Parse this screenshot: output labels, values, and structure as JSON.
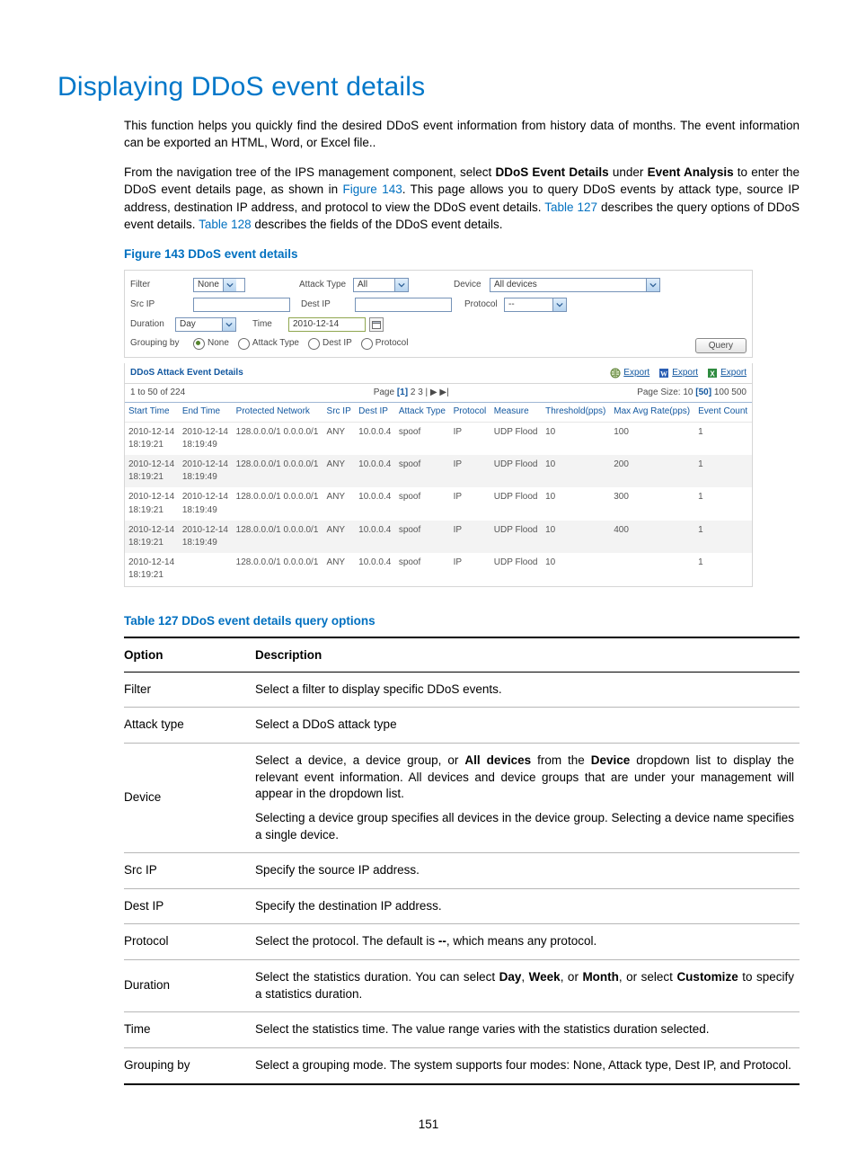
{
  "heading": "Displaying DDoS event details",
  "intro1": "This function helps you quickly find the desired DDoS event information from history data of months. The event information can be exported an HTML, Word, or Excel file..",
  "intro2": {
    "t1": "From the navigation tree of the IPS management component, select ",
    "b1": "DDoS Event Details",
    "t2": " under ",
    "b2": "Event Analysis",
    "t3": " to enter the DDoS event details page, as shown in ",
    "l1": "Figure 143",
    "t4": ". This page allows you to query DDoS events by attack type, source IP address, destination IP address, and protocol to view the DDoS event details. ",
    "l2": "Table 127",
    "t5": " describes the query options of DDoS event details. ",
    "l3": "Table 128",
    "t6": " describes the fields of the DDoS event details."
  },
  "figure_caption": "Figure 143 DDoS event details",
  "filters": {
    "filter_lbl": "Filter",
    "filter_val": "None",
    "attack_lbl": "Attack Type",
    "attack_val": "All",
    "device_lbl": "Device",
    "device_val": "All devices",
    "src_lbl": "Src IP",
    "dest_lbl": "Dest IP",
    "proto_lbl": "Protocol",
    "proto_val": "--",
    "dur_lbl": "Duration",
    "dur_val": "Day",
    "time_lbl": "Time",
    "time_val": "2010-12-14",
    "group_lbl": "Grouping by",
    "g_none": "None",
    "g_attack": "Attack Type",
    "g_dest": "Dest IP",
    "g_proto": "Protocol",
    "query_btn": "Query"
  },
  "details": {
    "title": "DDoS Attack Event Details",
    "export": "Export",
    "count": "1 to 50 of 224",
    "pager_prefix": "Page ",
    "pager_current": "[1]",
    "pager_rest": " 2 3 | ▶  ▶|",
    "pagesize_prefix": "Page Size: 10 ",
    "pagesize_mid": "[50]",
    "pagesize_suffix": " 100 500",
    "cols": [
      "Start Time",
      "End Time",
      "Protected Network",
      "Src IP",
      "Dest IP",
      "Attack Type",
      "Protocol",
      "Measure",
      "Threshold(pps)",
      "Max Avg Rate(pps)",
      "Event Count"
    ],
    "rows": [
      {
        "start": "2010-12-14 18:19:21",
        "end": "2010-12-14 18:19:49",
        "net": "128.0.0.0/1 0.0.0.0/1",
        "src": "ANY",
        "dst": "10.0.0.4",
        "atk": "spoof",
        "proto": "IP",
        "meas": "UDP Flood",
        "th": "10",
        "rate": "100",
        "cnt": "1"
      },
      {
        "start": "2010-12-14 18:19:21",
        "end": "2010-12-14 18:19:49",
        "net": "128.0.0.0/1 0.0.0.0/1",
        "src": "ANY",
        "dst": "10.0.0.4",
        "atk": "spoof",
        "proto": "IP",
        "meas": "UDP Flood",
        "th": "10",
        "rate": "200",
        "cnt": "1"
      },
      {
        "start": "2010-12-14 18:19:21",
        "end": "2010-12-14 18:19:49",
        "net": "128.0.0.0/1 0.0.0.0/1",
        "src": "ANY",
        "dst": "10.0.0.4",
        "atk": "spoof",
        "proto": "IP",
        "meas": "UDP Flood",
        "th": "10",
        "rate": "300",
        "cnt": "1"
      },
      {
        "start": "2010-12-14 18:19:21",
        "end": "2010-12-14 18:19:49",
        "net": "128.0.0.0/1 0.0.0.0/1",
        "src": "ANY",
        "dst": "10.0.0.4",
        "atk": "spoof",
        "proto": "IP",
        "meas": "UDP Flood",
        "th": "10",
        "rate": "400",
        "cnt": "1"
      },
      {
        "start": "2010-12-14 18:19:21",
        "end": "",
        "net": "128.0.0.0/1 0.0.0.0/1",
        "src": "ANY",
        "dst": "10.0.0.4",
        "atk": "spoof",
        "proto": "IP",
        "meas": "UDP Flood",
        "th": "10",
        "rate": "",
        "cnt": "1"
      }
    ]
  },
  "table127": {
    "caption": "Table 127 DDoS event details query options",
    "head_opt": "Option",
    "head_desc": "Description",
    "rows": [
      {
        "opt": "Filter",
        "desc": [
          {
            "t": "Select a filter to display specific DDoS events."
          }
        ]
      },
      {
        "opt": "Attack type",
        "desc": [
          {
            "t": "Select a DDoS attack type"
          }
        ]
      },
      {
        "opt": "Device",
        "desc": [
          {
            "t": "Select a device, a device group, or ",
            "b": "All devices",
            "t2": " from the ",
            "b2": "Device",
            "t3": " dropdown list to display the relevant event information. All devices and device groups that are under your management will appear in the dropdown list."
          },
          {
            "t": "Selecting a device group specifies all devices in the device group. Selecting a device name specifies a single device."
          }
        ]
      },
      {
        "opt": "Src IP",
        "desc": [
          {
            "t": "Specify the source IP address."
          }
        ]
      },
      {
        "opt": "Dest IP",
        "desc": [
          {
            "t": "Specify the destination IP address."
          }
        ]
      },
      {
        "opt": "Protocol",
        "desc": [
          {
            "t": "Select the protocol. The default is ",
            "b": "--",
            "t2": ", which means any protocol."
          }
        ]
      },
      {
        "opt": "Duration",
        "desc": [
          {
            "t": "Select the statistics duration. You can select ",
            "b": "Day",
            "t2": ", ",
            "b2": "Week",
            "t3": ", or ",
            "b3": "Month",
            "t4": ", or select ",
            "b4": "Customize",
            "t5": " to specify a statistics duration."
          }
        ]
      },
      {
        "opt": "Time",
        "desc": [
          {
            "t": "Select the statistics time. The value range varies with the statistics duration selected."
          }
        ]
      },
      {
        "opt": "Grouping by",
        "desc": [
          {
            "t": "Select a grouping mode. The system supports four modes: None, Attack type, Dest IP, and Protocol."
          }
        ]
      }
    ]
  },
  "page_number": "151"
}
